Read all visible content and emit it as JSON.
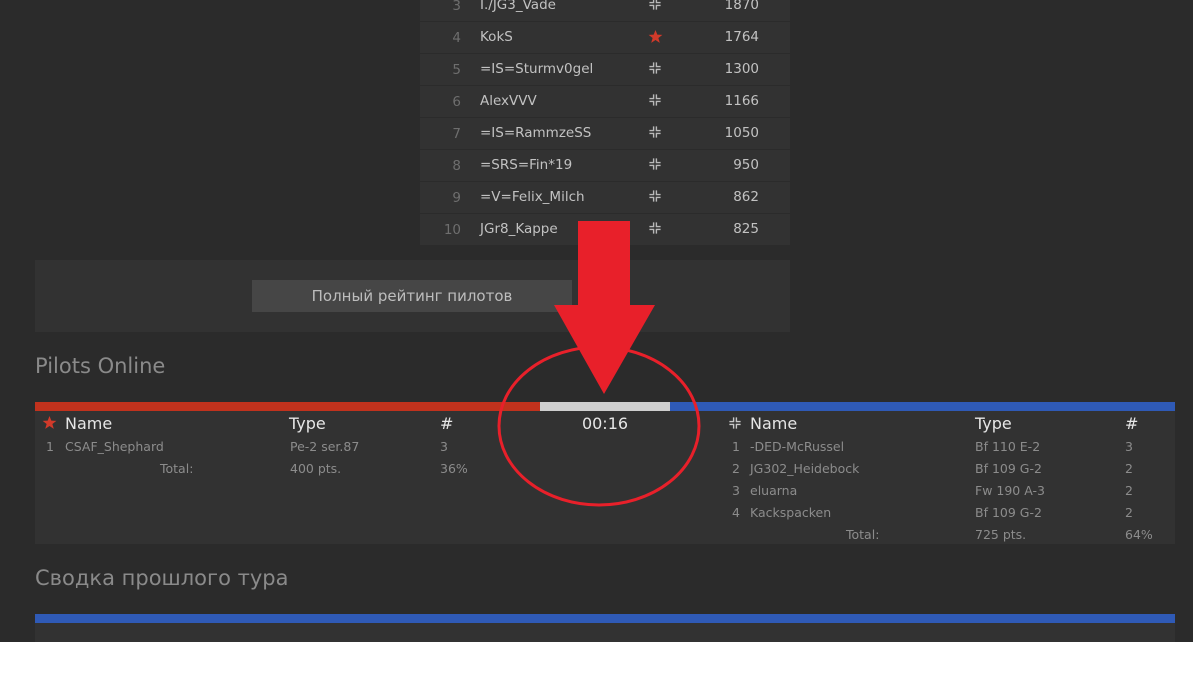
{
  "leaderboard": {
    "rows": [
      {
        "rank": "3",
        "name": "I./JG3_Vade",
        "side": "cross",
        "points": "1870"
      },
      {
        "rank": "4",
        "name": "KokS",
        "side": "star",
        "points": "1764"
      },
      {
        "rank": "5",
        "name": "=IS=Sturmv0gel",
        "side": "cross",
        "points": "1300"
      },
      {
        "rank": "6",
        "name": "AlexVVV",
        "side": "cross",
        "points": "1166"
      },
      {
        "rank": "7",
        "name": "=IS=RammzeSS",
        "side": "cross",
        "points": "1050"
      },
      {
        "rank": "8",
        "name": "=SRS=Fin*19",
        "side": "cross",
        "points": "950"
      },
      {
        "rank": "9",
        "name": "=V=Felix_Milch",
        "side": "cross",
        "points": "862"
      },
      {
        "rank": "10",
        "name": "JGr8_Kappe",
        "side": "cross",
        "points": "825"
      }
    ],
    "full_rating_button": "Полный рейтинг пилотов"
  },
  "pilots_online": {
    "title": "Pilots Online",
    "timer": "00:16",
    "red_share": 0.36,
    "blue_share": 0.64,
    "red": {
      "icon": "star-icon",
      "headers": {
        "name": "Name",
        "type": "Type",
        "count": "#"
      },
      "pilots": [
        {
          "num": "1",
          "name": "CSAF_Shephard",
          "type": "Pe-2 ser.87",
          "count": "3"
        }
      ],
      "total_label": "Total:",
      "total_points": "400 pts.",
      "total_percent": "36%"
    },
    "blue": {
      "icon": "balkenkreuz-icon",
      "headers": {
        "name": "Name",
        "type": "Type",
        "count": "#"
      },
      "pilots": [
        {
          "num": "1",
          "name": "-DED-McRussel",
          "type": "Bf 110 E-2",
          "count": "3"
        },
        {
          "num": "2",
          "name": "JG302_Heidebock",
          "type": "Bf 109 G-2",
          "count": "2"
        },
        {
          "num": "3",
          "name": "eluarna",
          "type": "Fw 190 A-3",
          "count": "2"
        },
        {
          "num": "4",
          "name": "Kackspacken",
          "type": "Bf 109 G-2",
          "count": "2"
        }
      ],
      "total_label": "Total:",
      "total_points": "725 pts.",
      "total_percent": "64%"
    }
  },
  "summary": {
    "title": "Сводка прошлого тура"
  },
  "colors": {
    "background": "#2b2b2b",
    "panel": "#323232",
    "red_side": "#c1321d",
    "blue_side": "#2f5ab6",
    "neutral": "#cfcfcf",
    "annotation_red": "#e8202a"
  }
}
